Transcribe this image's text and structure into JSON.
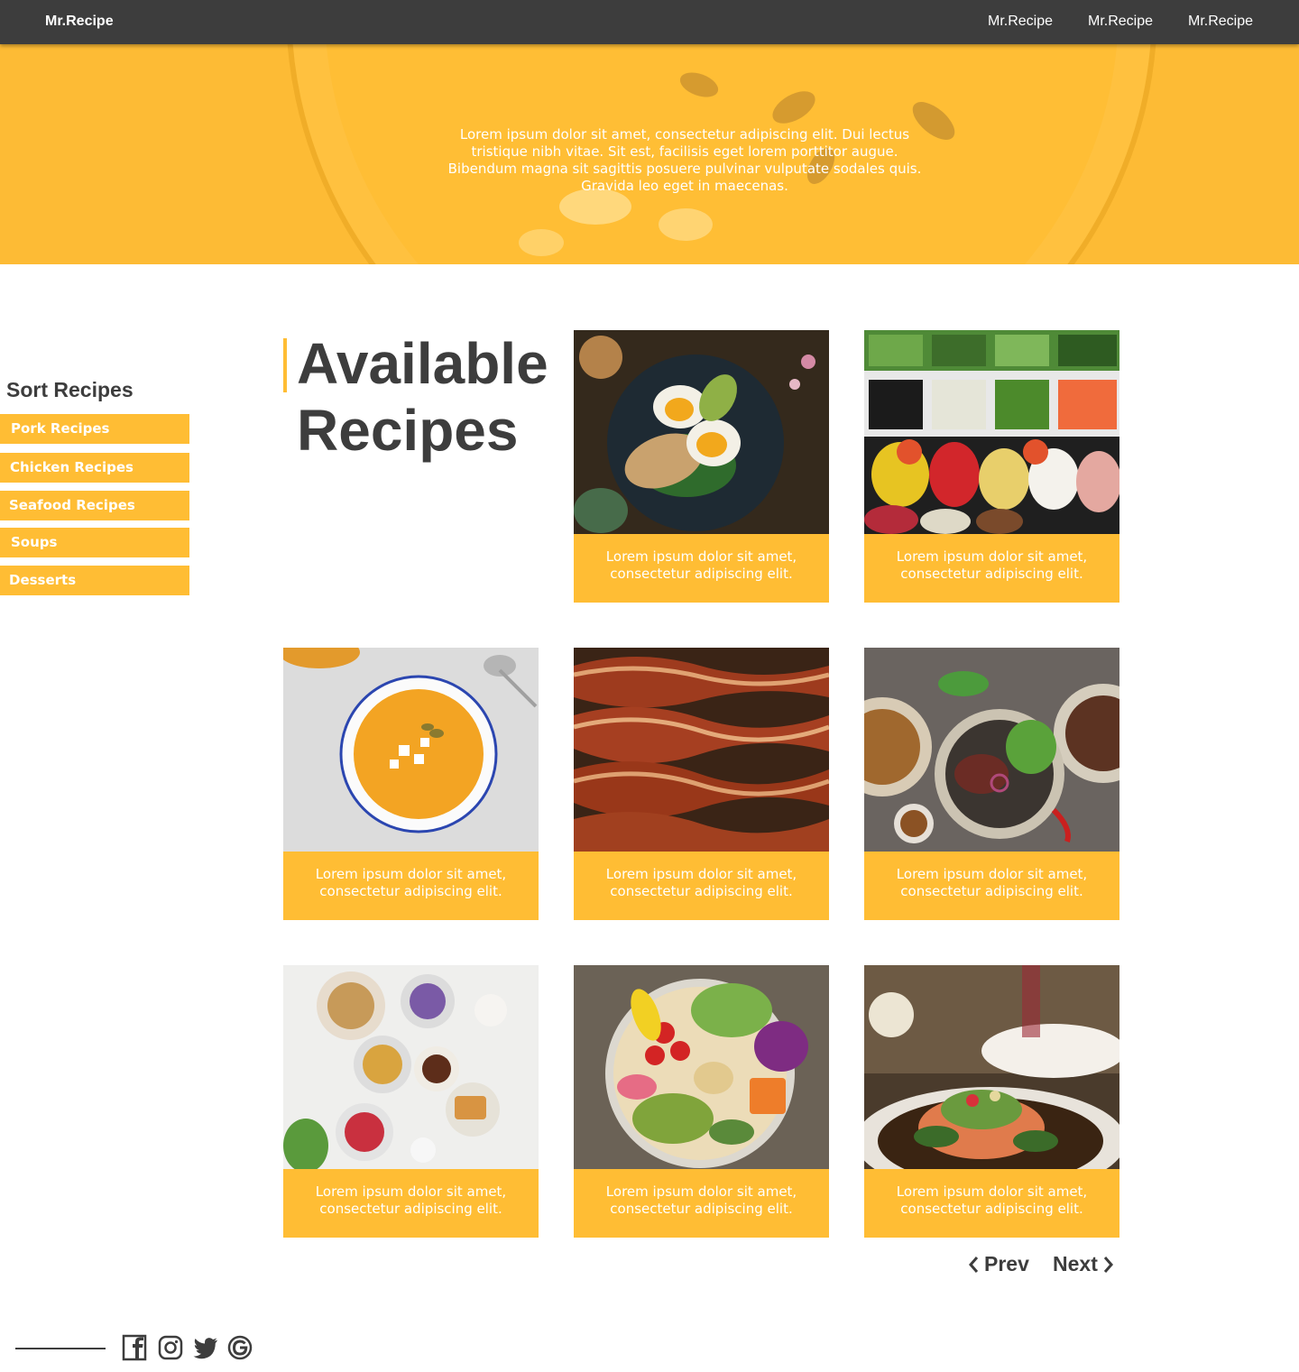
{
  "navbar": {
    "brand": "Mr.Recipe",
    "links": [
      "Mr.Recipe",
      "Mr.Recipe",
      "Mr.Recipe"
    ]
  },
  "hero": {
    "text": "Lorem ipsum dolor sit amet, consectetur adipiscing elit. Dui lectus tristique nibh vitae. Sit est, facilisis eget lorem porttitor augue. Bibendum magna sit sagittis posuere pulvinar vulputate sodales quis. Gravida leo eget in maecenas."
  },
  "sidebar": {
    "title": "Sort Recipes",
    "items": [
      {
        "label": "Pork Recipes"
      },
      {
        "label": "Chicken Recipes"
      },
      {
        "label": "Seafood Recipes"
      },
      {
        "label": "Soups"
      },
      {
        "label": "Desserts"
      }
    ]
  },
  "main": {
    "heading_line1": "Available",
    "heading_line2": "Recipes",
    "cards": [
      {
        "image": "egg-toast-photo",
        "caption": "Lorem ipsum dolor sit amet, consectetur adipiscing elit."
      },
      {
        "image": "salad-bar-photo",
        "caption": "Lorem ipsum dolor sit amet, consectetur adipiscing elit."
      },
      {
        "image": "pumpkin-soup-photo",
        "caption": "Lorem ipsum dolor sit amet, consectetur adipiscing elit."
      },
      {
        "image": "bacon-photo",
        "caption": "Lorem ipsum dolor sit amet, consectetur adipiscing elit."
      },
      {
        "image": "steak-salad-photo",
        "caption": "Lorem ipsum dolor sit amet, consectetur adipiscing elit."
      },
      {
        "image": "breakfast-bowls-photo",
        "caption": "Lorem ipsum dolor sit amet, consectetur adipiscing elit."
      },
      {
        "image": "veggie-bowl-photo",
        "caption": "Lorem ipsum dolor sit amet, consectetur adipiscing elit."
      },
      {
        "image": "salmon-dish-photo",
        "caption": "Lorem ipsum dolor sit amet, consectetur adipiscing elit."
      }
    ]
  },
  "pagination": {
    "prev": "Prev",
    "next": "Next"
  },
  "footer": {
    "social": [
      "facebook-icon",
      "instagram-icon",
      "twitter-icon",
      "google-icon"
    ]
  },
  "colors": {
    "accent": "#ffbd34",
    "navbar": "#3d3d3d",
    "text_dark": "#3d3d3d"
  }
}
